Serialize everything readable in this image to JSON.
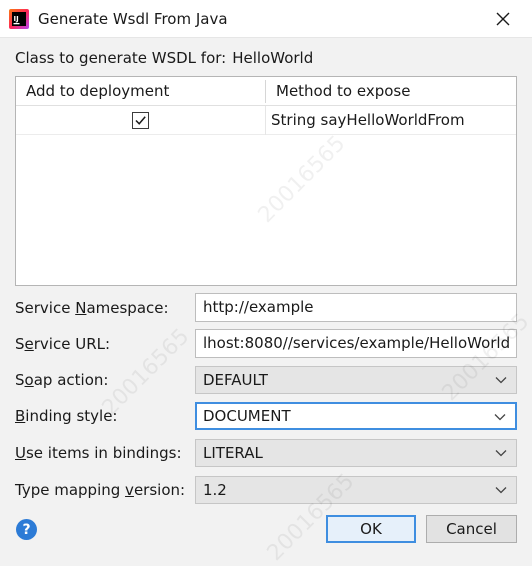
{
  "window": {
    "title": "Generate Wsdl From Java",
    "icon": "intellij-app-icon",
    "close_icon": "close-icon"
  },
  "class_row": {
    "label": "Class to generate WSDL for:",
    "value": "HelloWorld"
  },
  "table": {
    "headers": [
      "Add to deployment",
      "Method to expose"
    ],
    "rows": [
      {
        "checked": true,
        "method": "String sayHelloWorldFrom"
      }
    ]
  },
  "form": {
    "service_namespace": {
      "label_pre": "Service ",
      "label_mn": "N",
      "label_post": "amespace:",
      "value": "http://example"
    },
    "service_url": {
      "label_pre": "S",
      "label_mn": "e",
      "label_post": "rvice URL:",
      "value": "lhost:8080//services/example/HelloWorld"
    },
    "soap_action": {
      "label_pre": "S",
      "label_mn": "o",
      "label_post": "ap action:",
      "value": "DEFAULT"
    },
    "binding_style": {
      "label_pre": "",
      "label_mn": "B",
      "label_post": "inding style:",
      "value": "DOCUMENT"
    },
    "use_items": {
      "label_pre": "",
      "label_mn": "U",
      "label_post": "se items in bindings:",
      "value": "LITERAL"
    },
    "type_mapping": {
      "label_pre": "Type mapping ",
      "label_mn": "v",
      "label_post": "ersion:",
      "value": "1.2"
    }
  },
  "buttons": {
    "help": "?",
    "ok": "OK",
    "cancel": "Cancel"
  },
  "watermark": "20016565",
  "colors": {
    "accent": "#3f8ee0",
    "help_icon": "#2c7bd6",
    "dialog_bg": "#f2f2f2"
  }
}
